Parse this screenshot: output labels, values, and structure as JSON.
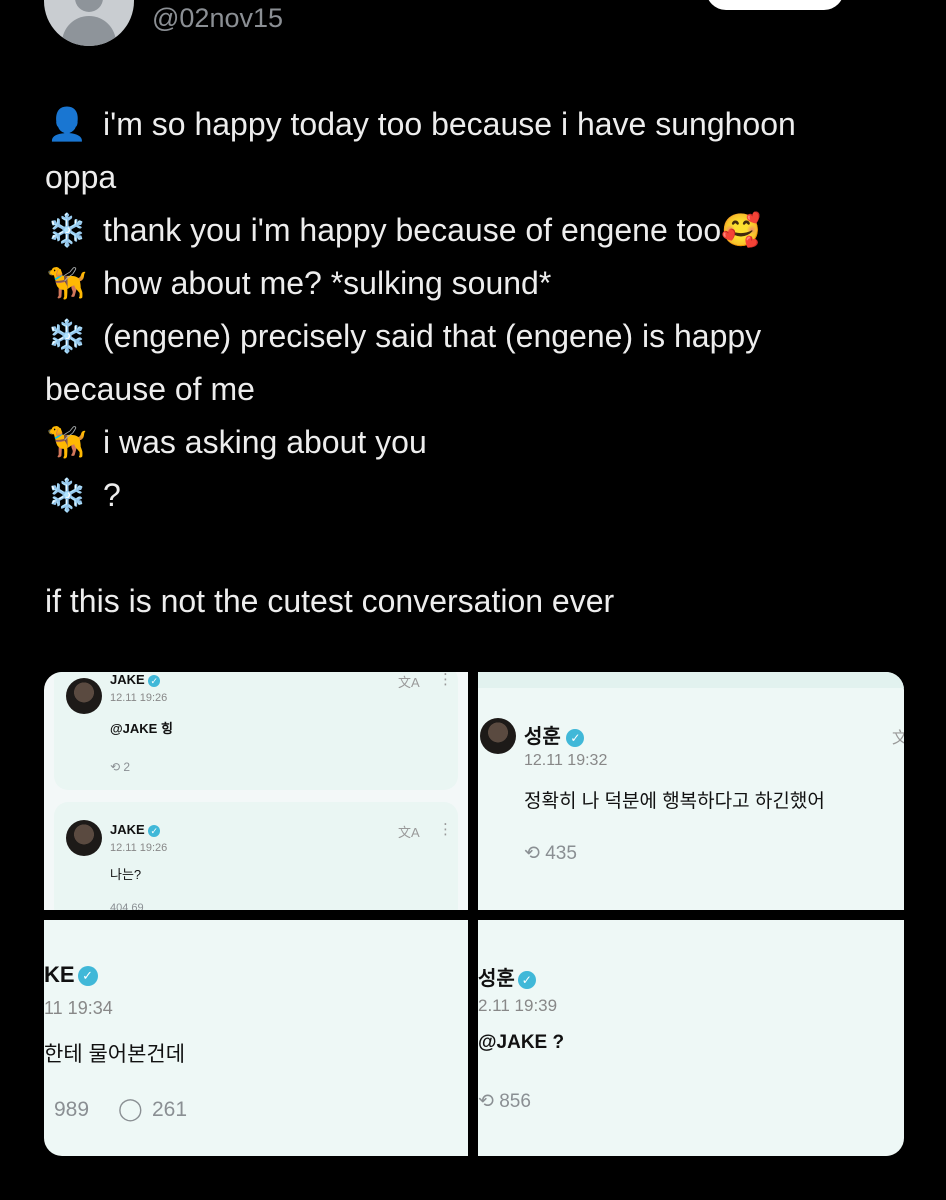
{
  "header": {
    "handle": "@02nov15"
  },
  "tweet": {
    "lines": [
      {
        "emoji": "👤",
        "text": "i'm so happy today too because i have sunghoon"
      },
      {
        "emoji": "",
        "text": "oppa"
      },
      {
        "emoji": "❄️",
        "text": "thank you i'm happy because of engene too🥰"
      },
      {
        "emoji": "🦮",
        "text": "how about me? *sulking sound*"
      },
      {
        "emoji": "❄️",
        "text": "(engene) precisely said that (engene) is happy"
      },
      {
        "emoji": "",
        "text": "because of me"
      },
      {
        "emoji": "🦮",
        "text": "i was asking about you"
      },
      {
        "emoji": "❄️",
        "text": "?"
      }
    ],
    "closing": "if this is not the cutest conversation ever"
  },
  "media": {
    "panel1": {
      "post1": {
        "name": "JAKE",
        "time": "12.11 19:26",
        "body": "@JAKE 힝",
        "replies": "2"
      },
      "post2": {
        "name": "JAKE",
        "time": "12.11 19:26",
        "body": "나는?",
        "cut_stats": "404   69"
      }
    },
    "panel2": {
      "name": "성훈",
      "time": "12.11 19:32",
      "body": "정확히 나 덕분에 행복하다고 하긴했어",
      "replies": "435"
    },
    "panel3": {
      "name": "KE",
      "time": "11 19:34",
      "body": "한테 물어본건데",
      "replies": "989",
      "comments": "261"
    },
    "panel4": {
      "name": "성훈",
      "time": "2.11 19:39",
      "body": "@JAKE ?",
      "replies": "856"
    }
  },
  "colors": {
    "background": "#000000",
    "text": "#ededed",
    "handle": "#8b8f94",
    "panel": "#eef8f6",
    "verified": "#40b8d8"
  }
}
